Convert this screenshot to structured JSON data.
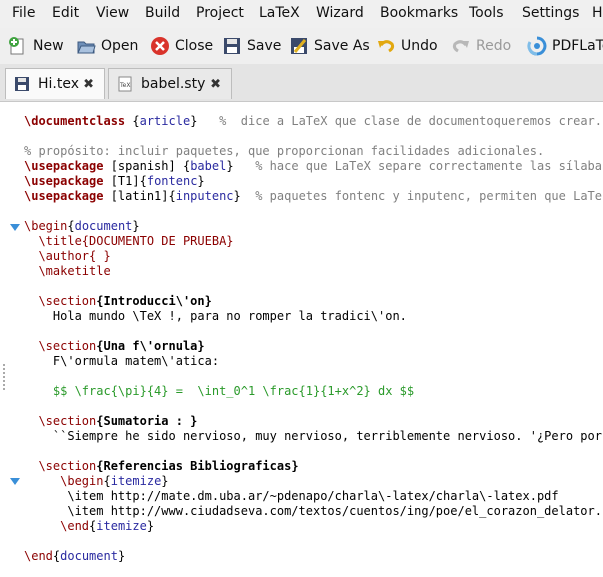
{
  "menubar": {
    "items": [
      "File",
      "Edit",
      "View",
      "Build",
      "Project",
      "LaTeX",
      "Wizard",
      "Bookmarks",
      "Tools",
      "Settings",
      "H"
    ]
  },
  "toolbar": {
    "new_label": "New",
    "open_label": "Open",
    "close_label": "Close",
    "save_label": "Save",
    "save_as_label": "Save As",
    "undo_label": "Undo",
    "redo_label": "Redo",
    "pdflatex_label": "PDFLaTe"
  },
  "tabs": [
    {
      "label": "Hi.tex",
      "active": true
    },
    {
      "label": "babel.sty",
      "active": false
    }
  ],
  "editor": {
    "lines": [
      {
        "kw": "\\documentclass",
        "p2": " {",
        "br": "article",
        "p3": "}   ",
        "cm": "%  dice a LaTeX que clase de documentoqueremos crear."
      },
      {
        "cm": "% propósito: incluir paquetes, que proporcionan facilidades adicionales."
      },
      {
        "kw": "\\usepackage",
        "p2": " [spanish] {",
        "br": "babel",
        "p3": "}   ",
        "cm": "% hace que LaTeX separe correctamente las sílaba"
      },
      {
        "kw": "\\usepackage",
        "p2": " [T1]{",
        "br": "fontenc",
        "p3": "}"
      },
      {
        "kw": "\\usepackage",
        "p2": " [latin1]{",
        "br": "inputenc",
        "p3": "}  ",
        "cm": "% paquetes fontenc y inputenc, permiten que LaTe"
      },
      {
        "kw_plain": "\\begin",
        "p2": "{",
        "br": "document",
        "p3": "}"
      },
      {
        "plain": "  \\title{DOCUMENTO DE PRUEBA}"
      },
      {
        "plain": "  \\author{ }"
      },
      {
        "plain": "  \\maketitle"
      },
      {
        "sec_cmd": "  \\section",
        "sec_title": "{Introducci\\'on}"
      },
      {
        "plain": "    Hola mundo \\TeX !, para no romper la tradici\\'on."
      },
      {
        "sec_cmd": "  \\section",
        "sec_title": "{Una f\\'ornula}"
      },
      {
        "plain": "    F\\'ormula matem\\'atica:"
      },
      {
        "math": "    $$ \\frac{\\pi}{4} =  \\int_0^1 \\frac{1}{1+x^2} dx $$"
      },
      {
        "sec_cmd": "  \\section",
        "sec_title": "{Sumatoria : }"
      },
      {
        "plain": "    ``Siempre he sido nervioso, muy nervioso, terriblemente nervioso. '¿Pero por"
      },
      {
        "sec_cmd": "  \\section",
        "sec_title": "{Referencias Bibliograficas}"
      },
      {
        "plain_begin": "     \\begin",
        "br": "itemize"
      },
      {
        "plain": "      \\item http://mate.dm.uba.ar/~pdenapo/charla\\-latex/charla\\-latex.pdf"
      },
      {
        "plain": "      \\item http://www.ciudadseva.com/textos/cuentos/ing/poe/el_corazon_delator."
      },
      {
        "plain_end": "     \\end",
        "br": "itemize"
      },
      {
        "kw_plain": "\\end",
        "p2": "{",
        "br": "document",
        "p3": "}"
      }
    ]
  },
  "colors": {
    "keyword": "#8b0000",
    "comment": "#808080",
    "argument": "#2a2aa0",
    "math": "#2a9a2a",
    "fold_marker": "#3a8fd8"
  },
  "icons": {
    "new": "new-document-icon",
    "open": "open-folder-icon",
    "close": "close-red-icon",
    "save": "floppy-icon",
    "save_as": "save-as-icon",
    "undo": "undo-arrow-icon",
    "redo": "redo-arrow-icon",
    "pdflatex": "pdflatex-icon"
  }
}
